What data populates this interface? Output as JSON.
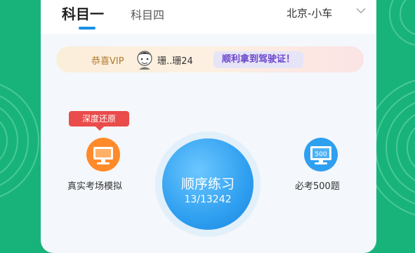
{
  "header": {
    "tabs": [
      {
        "label": "科目一",
        "active": true
      },
      {
        "label": "科目四",
        "active": false
      }
    ],
    "location": "北京-小车"
  },
  "banner": {
    "vip_label": "恭喜VIP",
    "username": "珊..珊24",
    "slogan": "顺利拿到驾驶证！"
  },
  "features": {
    "left": {
      "badge": "深度还原",
      "label": "真实考场模拟",
      "icon": "monitor-icon"
    },
    "right": {
      "label": "必考500题",
      "icon": "500-monitor-icon"
    }
  },
  "practice": {
    "title": "顺序练习",
    "progress": "13/13242"
  },
  "colors": {
    "background_green": "#18b37a",
    "accent_blue": "#1a8fe8",
    "badge_red": "#ea4b4b",
    "slogan_purple": "#6b45c8"
  }
}
